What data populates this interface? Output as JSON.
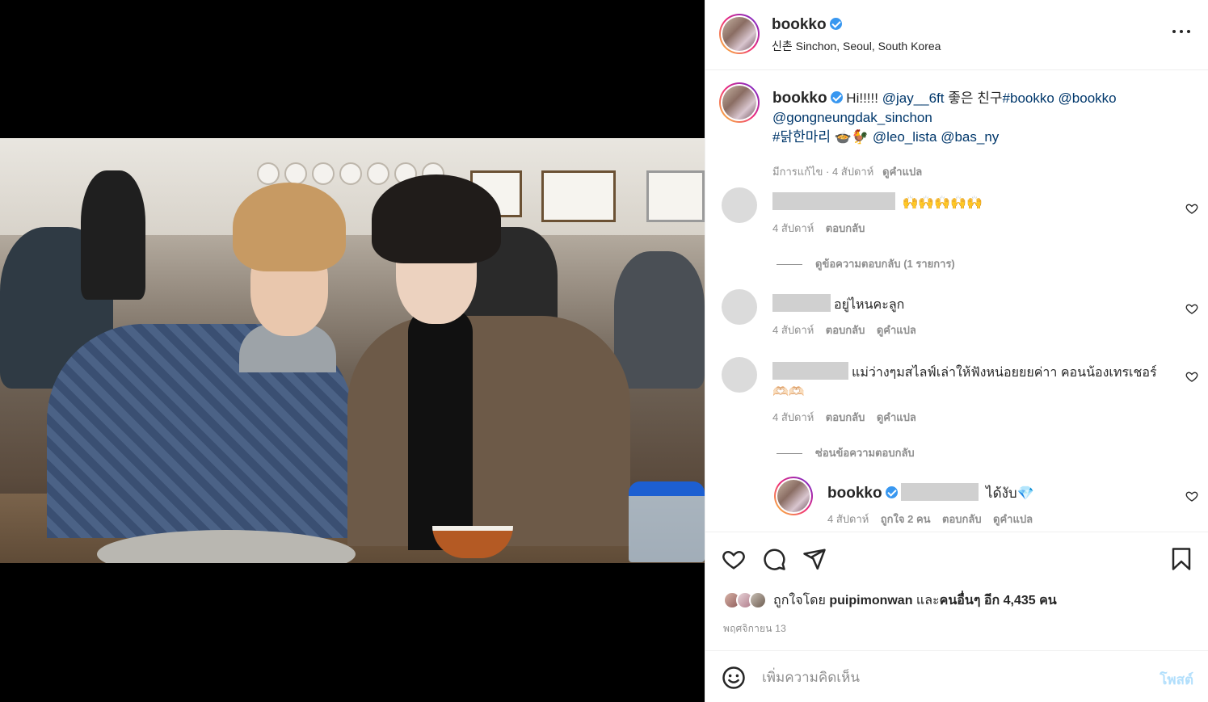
{
  "header": {
    "username": "bookko",
    "location": "신촌 Sinchon, Seoul, South Korea"
  },
  "caption": {
    "username": "bookko",
    "text_plain": "Hi!!!!! ",
    "mention_1": "@jay__6ft",
    "text_korean": " 좋은 친구",
    "hashtag_1": "#bookko",
    "mention_2": "@bookko",
    "mention_3": "@gongneungdak_sinchon",
    "hashtag_2": "#닭한마리",
    "emoji": "🍲🐓",
    "mention_4": "@leo_lista",
    "mention_5": "@bas_ny",
    "edited": "มีการแก้ไข · 4 สัปดาห์",
    "translate": "ดูคำแปล"
  },
  "comments": [
    {
      "text": "🙌🙌🙌🙌🙌",
      "time": "4 สัปดาห์",
      "reply_label": "ตอบกลับ",
      "view_replies": "ดูข้อความตอบกลับ (1 รายการ)"
    },
    {
      "text": "อยู่ไหนคะลูก",
      "time": "4 สัปดาห์",
      "reply_label": "ตอบกลับ",
      "translate": "ดูคำแปล"
    },
    {
      "text": "แม่ว่างๆมสไลฟ์เล่าให้ฟังหน่อยยยค่าา คอนน้องเทรเชอร์ 🫶🏻🫶🏻",
      "time": "4 สัปดาห์",
      "reply_label": "ตอบกลับ",
      "translate": "ดูคำแปล",
      "hide_replies": "ซ่อนข้อความตอบกลับ"
    }
  ],
  "reply": {
    "username": "bookko",
    "text": "ได้งับ💎",
    "time": "4 สัปดาห์",
    "likes": "ถูกใจ 2 คน",
    "reply_label": "ตอบกลับ",
    "translate": "ดูคำแปล"
  },
  "likes": {
    "prefix": "ถูกใจโดย ",
    "user": "puipimonwan",
    "mid": " และ",
    "others": "คนอื่นๆ อีก 4,435 คน"
  },
  "post_date": "พฤศจิกายน 13",
  "add_comment": {
    "placeholder": "เพิ่มความคิดเห็น",
    "post_label": "โพสต์"
  },
  "colors": {
    "link": "#00376b",
    "verified": "#3897f0",
    "post_button_disabled": "#b2dffc",
    "muted": "#8e8e8e"
  },
  "icons": [
    "more-icon",
    "heart-icon",
    "comment-icon",
    "share-icon",
    "bookmark-icon",
    "emoji-icon",
    "verified-badge"
  ]
}
